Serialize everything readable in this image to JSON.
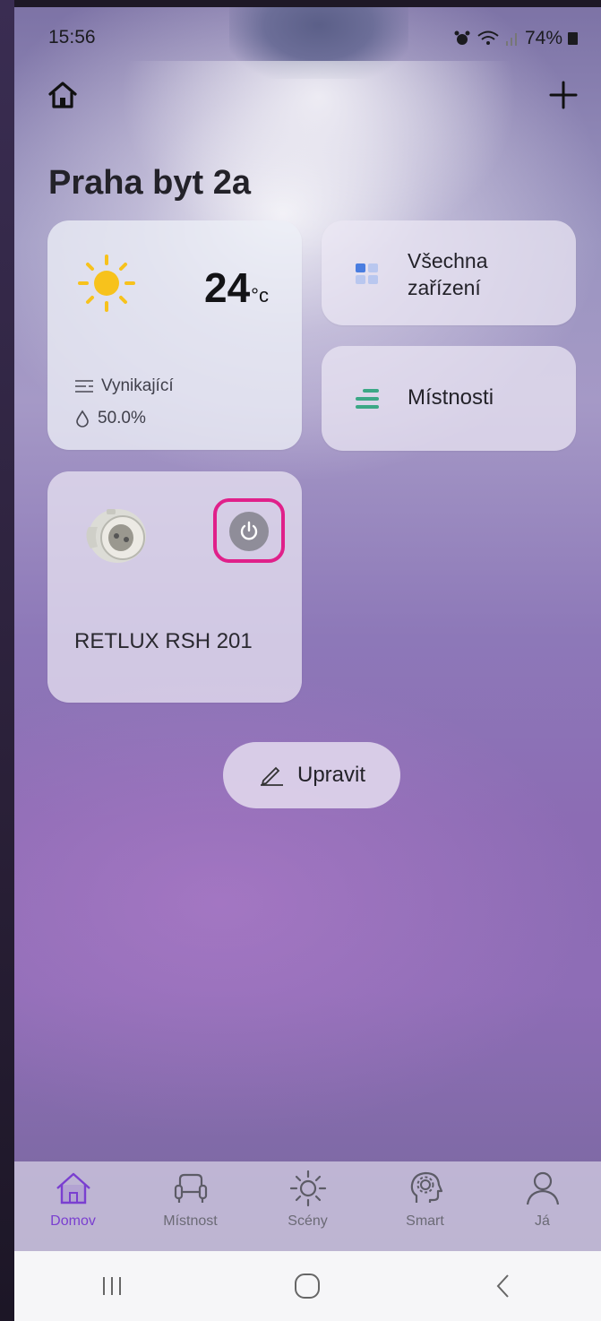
{
  "status_bar": {
    "time": "15:56",
    "battery": "74%"
  },
  "header": {
    "home_icon": "home-icon",
    "add_icon": "plus-icon"
  },
  "page_title": "Praha byt 2a",
  "weather": {
    "temperature": "24",
    "unit": "°c",
    "condition": "Vynikající",
    "humidity": "50.0%"
  },
  "shortcuts": {
    "all_devices": "Všechna zařízení",
    "rooms": "Místnosti"
  },
  "device": {
    "name": "RETLUX RSH 201",
    "power_state": "off"
  },
  "edit_button": "Upravit",
  "tabs": [
    {
      "label": "Domov",
      "icon": "home-icon",
      "active": true
    },
    {
      "label": "Místnost",
      "icon": "armchair-icon",
      "active": false
    },
    {
      "label": "Scény",
      "icon": "sun-icon",
      "active": false
    },
    {
      "label": "Smart",
      "icon": "brain-gear-icon",
      "active": false
    },
    {
      "label": "Já",
      "icon": "user-icon",
      "active": false
    }
  ],
  "colors": {
    "accent": "#7a3fd0",
    "highlight": "#e0208a",
    "sun": "#f7c21c",
    "rooms_icon": "#3ca886",
    "devices_icon": "#4a7de0"
  }
}
